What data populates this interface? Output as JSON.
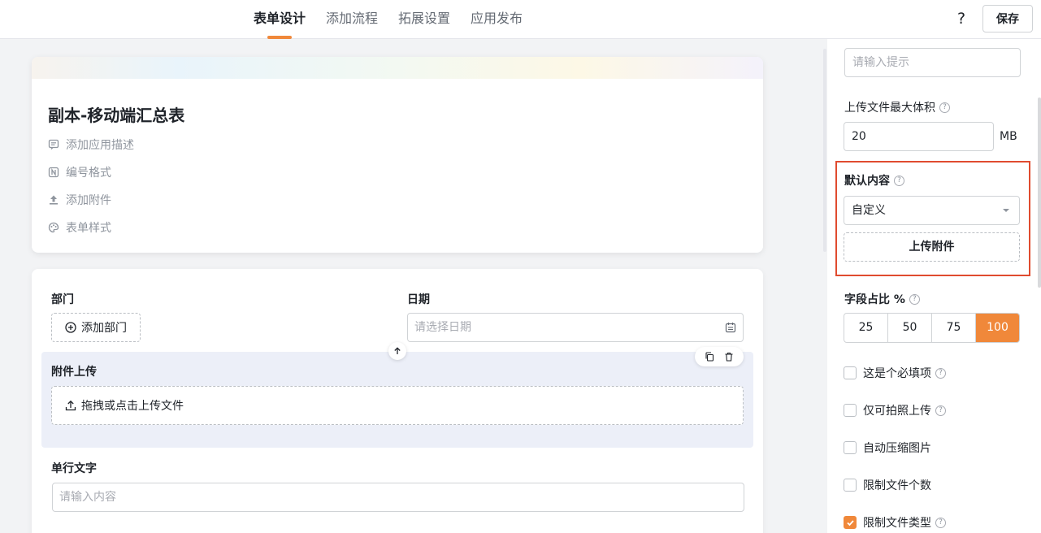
{
  "topbar": {
    "tabs": [
      {
        "label": "表单设计",
        "active": true
      },
      {
        "label": "添加流程",
        "active": false
      },
      {
        "label": "拓展设置",
        "active": false
      },
      {
        "label": "应用发布",
        "active": false
      }
    ],
    "help_label": "?",
    "save_label": "保存"
  },
  "header": {
    "title": "副本-移动端汇总表",
    "items": [
      "添加应用描述",
      "编号格式",
      "添加附件",
      "表单样式"
    ]
  },
  "form": {
    "dept_label": "部门",
    "dept_button": "添加部门",
    "date_label": "日期",
    "date_placeholder": "请选择日期",
    "attach_label": "附件上传",
    "upload_zone_text": "拖拽或点击上传文件",
    "text_label": "单行文字",
    "text_placeholder": "请输入内容"
  },
  "panel": {
    "hint_placeholder": "请输入提示",
    "max_size_label": "上传文件最大体积",
    "max_size_value": "20",
    "max_size_unit": "MB",
    "default_label": "默认内容",
    "default_select": "自定义",
    "upload_button": "上传附件",
    "ratio_label": "字段占比 %",
    "ratio_options": [
      "25",
      "50",
      "75",
      "100"
    ],
    "ratio_selected": "100",
    "checkboxes": [
      {
        "label": "这是个必填项",
        "checked": false,
        "help": true
      },
      {
        "label": "仅可拍照上传",
        "checked": false,
        "help": true
      },
      {
        "label": "自动压缩图片",
        "checked": false,
        "help": false
      },
      {
        "label": "限制文件个数",
        "checked": false,
        "help": false
      },
      {
        "label": "限制文件类型",
        "checked": true,
        "help": true
      }
    ],
    "help_glyph": "?"
  },
  "colors": {
    "accent": "#f0883a",
    "highlight": "#e04b2f"
  }
}
